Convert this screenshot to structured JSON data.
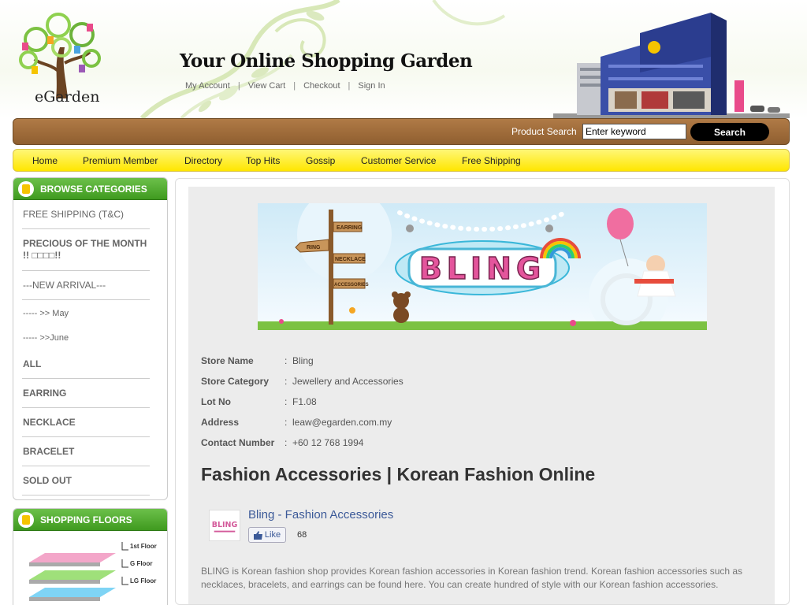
{
  "header": {
    "logo_text": "eGarden",
    "tagline": "Your Online Shopping Garden",
    "links": [
      "My Account",
      "View Cart",
      "Checkout",
      "Sign In"
    ]
  },
  "search": {
    "label": "Product Search",
    "value": "Enter keyword",
    "button": "Search"
  },
  "nav": [
    "Home",
    "Premium Member",
    "Directory",
    "Top Hits",
    "Gossip",
    "Customer Service",
    "Free Shipping"
  ],
  "sidebar": {
    "categories_title": "BROWSE CATEGORIES",
    "categories": [
      {
        "label": "FREE SHIPPING (T&C)"
      },
      {
        "label": "PRECIOUS OF THE MONTH !! □□□□!!"
      },
      {
        "label": "---NEW ARRIVAL---"
      },
      {
        "label": "----- >> May"
      },
      {
        "label": "----- >>June"
      },
      {
        "label": "ALL"
      },
      {
        "label": "EARRING"
      },
      {
        "label": "NECKLACE"
      },
      {
        "label": "BRACELET"
      },
      {
        "label": "SOLD OUT"
      }
    ],
    "floors_title": "SHOPPING FLOORS",
    "floors": [
      "1st Floor",
      "G Floor",
      "LG Floor"
    ]
  },
  "banner": {
    "word": "BLING",
    "signs": [
      "EARRING",
      "RING",
      "NECKLACE",
      "ACCESSORIES"
    ]
  },
  "store": {
    "rows": [
      {
        "label": "Store Name",
        "value": "Bling"
      },
      {
        "label": "Store Category",
        "value": "Jewellery and Accessories"
      },
      {
        "label": "Lot No",
        "value": "F1.08"
      },
      {
        "label": "Address",
        "value": "leaw@egarden.com.my"
      },
      {
        "label": "Contact Number",
        "value": "+60 12 768 1994"
      }
    ],
    "title": "Fashion Accessories | Korean Fashion Online"
  },
  "facebook": {
    "name": "Bling - Fashion Accessories",
    "logo_text": "BLING",
    "like_label": "Like",
    "count": "68"
  },
  "description": "BLING is Korean fashion shop provides Korean fashion accessories in Korean fashion trend. Korean fashion accessories such as necklaces, bracelets, and earrings can be found here. You can create hundred of style with our Korean fashion accessories.",
  "colors": {
    "brown_bar": "#9a6838",
    "yellow_nav": "#ffee2a",
    "green_head": "#4fab2c",
    "fb_blue": "#3b5998"
  }
}
